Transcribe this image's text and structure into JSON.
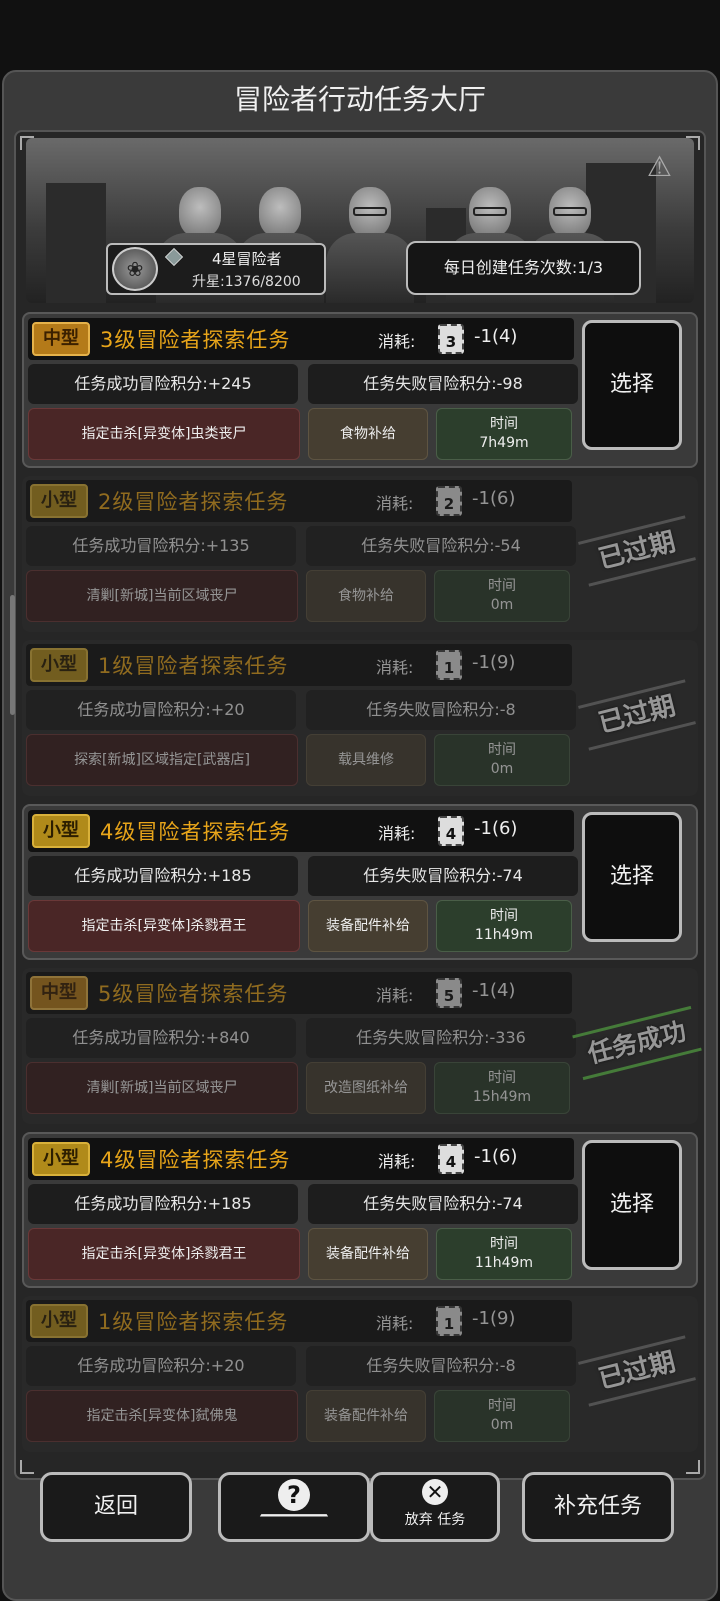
{
  "header": {
    "title": "冒险者行动任务大厅"
  },
  "rank": {
    "title": "4星冒险者",
    "progress": "升星:1376/8200"
  },
  "daily": {
    "label": "每日创建任务次数:1/3"
  },
  "cost_label": "消耗:",
  "time_label": "时间",
  "select_label": "选择",
  "missions": [
    {
      "size": "中型",
      "title": "3级冒险者探索任务",
      "level": "3",
      "cost": "-1(4)",
      "success": "任务成功冒险积分:+245",
      "fail": "任务失败冒险积分:-98",
      "objective": "指定击杀[异变体]虫类丧尸",
      "supply": "食物补给",
      "time": "7h49m",
      "state": "active"
    },
    {
      "size": "小型",
      "title": "2级冒险者探索任务",
      "level": "2",
      "cost": "-1(6)",
      "success": "任务成功冒险积分:+135",
      "fail": "任务失败冒险积分:-54",
      "objective": "清剿[新城]当前区域丧尸",
      "supply": "食物补给",
      "time": "0m",
      "state": "expired",
      "stamp": "已过期"
    },
    {
      "size": "小型",
      "title": "1级冒险者探索任务",
      "level": "1",
      "cost": "-1(9)",
      "success": "任务成功冒险积分:+20",
      "fail": "任务失败冒险积分:-8",
      "objective": "探索[新城]区域指定[武器店]",
      "supply": "载具维修",
      "time": "0m",
      "state": "expired",
      "stamp": "已过期"
    },
    {
      "size": "小型",
      "title": "4级冒险者探索任务",
      "level": "4",
      "cost": "-1(6)",
      "success": "任务成功冒险积分:+185",
      "fail": "任务失败冒险积分:-74",
      "objective": "指定击杀[异变体]杀戮君王",
      "supply": "装备配件补给",
      "time": "11h49m",
      "state": "active"
    },
    {
      "size": "中型",
      "title": "5级冒险者探索任务",
      "level": "5",
      "cost": "-1(4)",
      "success": "任务成功冒险积分:+840",
      "fail": "任务失败冒险积分:-336",
      "objective": "清剿[新城]当前区域丧尸",
      "supply": "改造图纸补给",
      "time": "15h49m",
      "state": "success",
      "stamp": "任务成功"
    },
    {
      "size": "小型",
      "title": "4级冒险者探索任务",
      "level": "4",
      "cost": "-1(6)",
      "success": "任务成功冒险积分:+185",
      "fail": "任务失败冒险积分:-74",
      "objective": "指定击杀[异变体]杀戮君王",
      "supply": "装备配件补给",
      "time": "11h49m",
      "state": "active"
    },
    {
      "size": "小型",
      "title": "1级冒险者探索任务",
      "level": "1",
      "cost": "-1(9)",
      "success": "任务成功冒险积分:+20",
      "fail": "任务失败冒险积分:-8",
      "objective": "指定击杀[异变体]弑佛鬼",
      "supply": "装备配件补给",
      "time": "0m",
      "state": "expired",
      "stamp": "已过期"
    }
  ],
  "bottom": {
    "back": "返回",
    "abandon": "放弃 任务",
    "refill": "补充任务"
  },
  "colors": {
    "title_gold": "#e8a51a",
    "objective_red": "#4a2626",
    "time_green": "#2c3e2c",
    "success_green": "#5fc24a"
  }
}
